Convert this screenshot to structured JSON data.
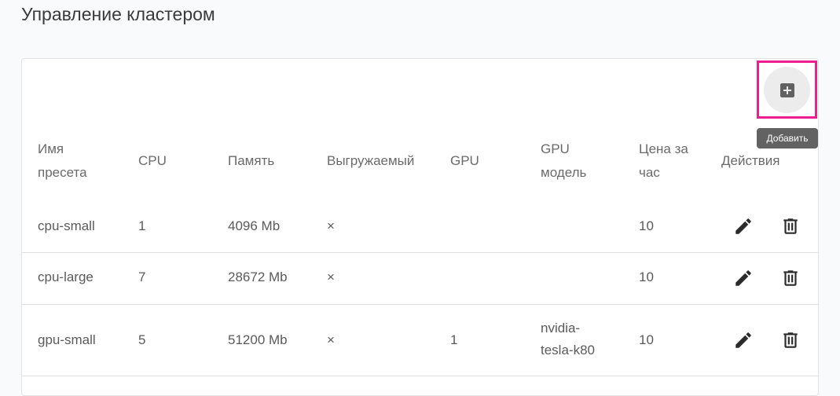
{
  "page": {
    "title": "Управление кластером"
  },
  "toolbar": {
    "add_tooltip": "Добавить",
    "add_icon": "add-box-icon"
  },
  "table": {
    "headers": {
      "name": [
        "Имя",
        "пресета"
      ],
      "cpu": "CPU",
      "memory": "Память",
      "preemptible": "Выгружаемый",
      "gpu": "GPU",
      "gpu_model": [
        "GPU",
        "модель"
      ],
      "price": [
        "Цена за",
        "час"
      ],
      "actions": "Действия"
    },
    "rows": [
      {
        "name": "cpu-small",
        "cpu": "1",
        "memory": "4096 Mb",
        "preemptible": "×",
        "gpu": "",
        "gpu_model": [
          "",
          ""
        ],
        "price": "10"
      },
      {
        "name": "cpu-large",
        "cpu": "7",
        "memory": "28672 Mb",
        "preemptible": "×",
        "gpu": "",
        "gpu_model": [
          "",
          ""
        ],
        "price": "10"
      },
      {
        "name": "gpu-small",
        "cpu": "5",
        "memory": "51200 Mb",
        "preemptible": "×",
        "gpu": "1",
        "gpu_model": [
          "nvidia-",
          "tesla-k80"
        ],
        "price": "10"
      }
    ],
    "row_actions": {
      "edit_icon": "pencil-icon",
      "delete_icon": "trash-icon"
    }
  },
  "colors": {
    "highlight": "#ee1e8e",
    "tooltip_bg": "#626262",
    "icon": "#2b2b2b"
  }
}
